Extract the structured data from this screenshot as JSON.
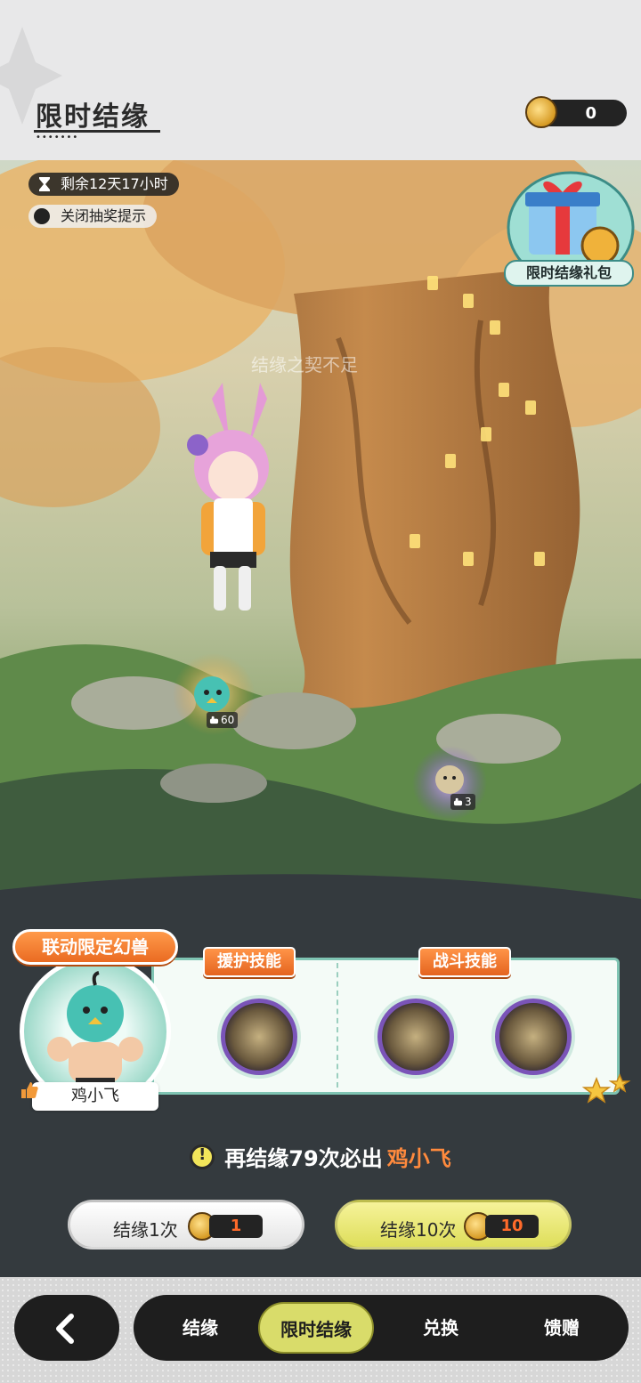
{
  "header": {
    "title": "限时结缘",
    "currency_value": "0"
  },
  "scene": {
    "timer_text": "剩余12天17小时",
    "toggle_text": "关闭抽奖提示",
    "gift_label": "限时结缘礼包",
    "hint_text": "结缘之契不足",
    "pet_badges": [
      "60",
      "3"
    ]
  },
  "beast_panel": {
    "limited_tag": "联动限定幻兽",
    "beast_name": "鸡小飞",
    "support_title": "援护技能",
    "battle_title": "战斗技能"
  },
  "pity": {
    "text": "再结缘79次必出",
    "name": "鸡小飞"
  },
  "draw": {
    "single_label": "结缘1次",
    "single_cost": "1",
    "ten_label": "结缘10次",
    "ten_cost": "10"
  },
  "nav": {
    "tabs": [
      "结缘",
      "限时结缘",
      "兑换",
      "馈赠"
    ],
    "active": "限时结缘"
  },
  "colors": {
    "accent_orange": "#e4641f",
    "active_tab": "#d9dc6a",
    "pity_name": "#ff8a3d"
  }
}
